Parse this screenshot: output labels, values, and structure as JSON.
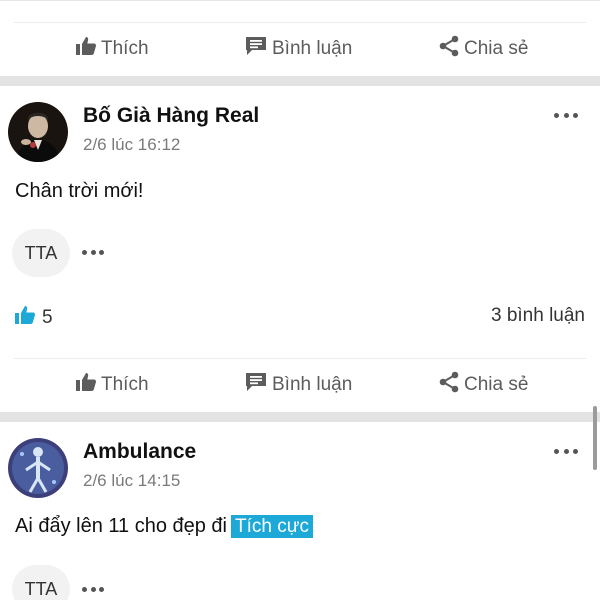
{
  "actions": {
    "like_label": "Thích",
    "comment_label": "Bình luận",
    "share_label": "Chia sẻ"
  },
  "icons": {
    "like": "thumbs-up-icon",
    "comment": "comment-icon",
    "share": "share-icon",
    "more": "more-horizontal-icon"
  },
  "colors": {
    "accent": "#1ca9d8",
    "divider": "#e3e3e3",
    "muted_text": "#7a7a7a"
  },
  "posts": [
    {
      "author": "Bố Già Hàng Real",
      "time": "2/6 lúc 16:12",
      "content": "Chân trời mới!",
      "reactor": "TTA",
      "like_count": "5",
      "comment_count": "3 bình luận"
    },
    {
      "author": "Ambulance",
      "time": "2/6 lúc 14:15",
      "content": "Ai đẩy lên 11 cho đẹp đi",
      "tag": "Tích cực",
      "reactor": "TTA"
    }
  ]
}
